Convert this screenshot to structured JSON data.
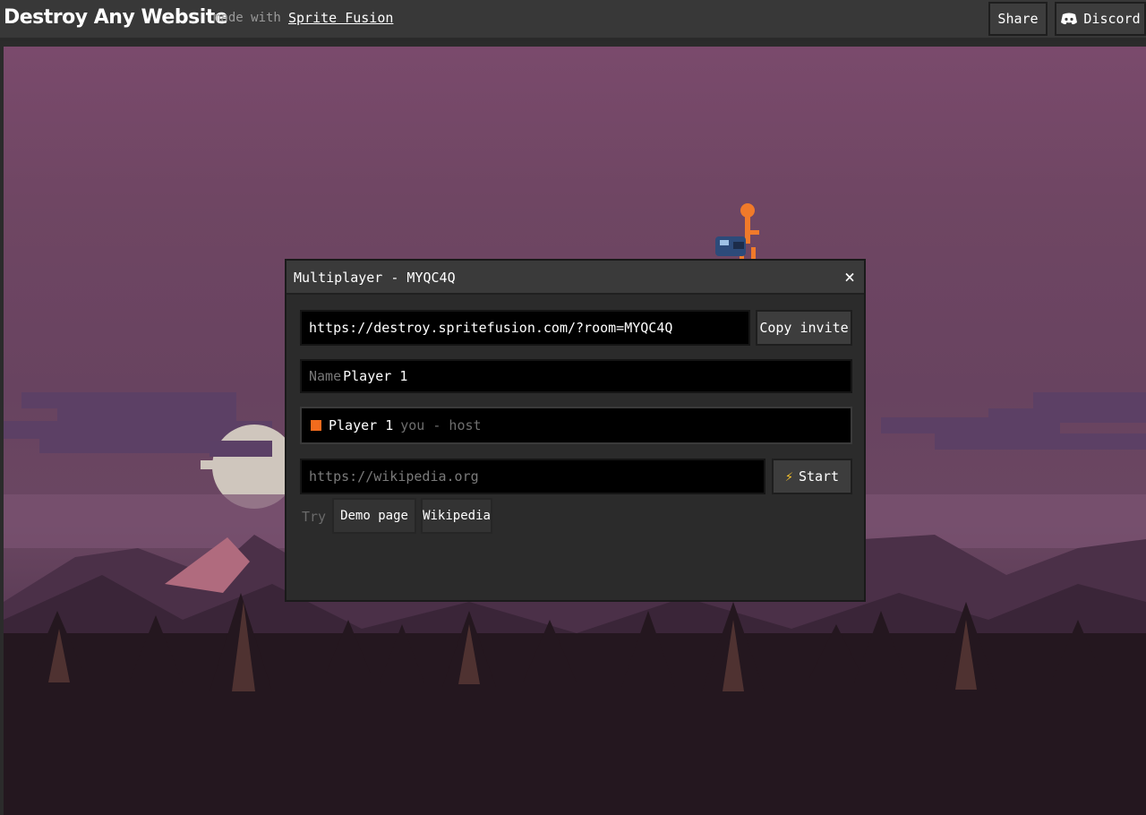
{
  "header": {
    "title": "Destroy Any Website",
    "made_with": "made with",
    "made_with_link": "Sprite Fusion",
    "share_label": "Share",
    "discord_label": "Discord"
  },
  "modal": {
    "title": "Multiplayer - MYQC4Q",
    "close_glyph": "×",
    "invite_url": "https://destroy.spritefusion.com/?room=MYQC4Q",
    "copy_invite_label": "Copy invite",
    "name_label": "Name",
    "name_value": "Player 1",
    "players": [
      {
        "name": "Player 1",
        "tag": "you - host",
        "color": "#f26b1d"
      }
    ],
    "site_placeholder": "https://wikipedia.org",
    "start_label": "Start",
    "start_icon": "lightning-icon",
    "try_label": "Try",
    "try_options": [
      "Demo page",
      "Wikipedia"
    ]
  },
  "colors": {
    "sky_top": "#7a4a6c",
    "sky_mid": "#684360",
    "accent_orange": "#f26b1d",
    "bolt_yellow": "#f6c12c"
  }
}
